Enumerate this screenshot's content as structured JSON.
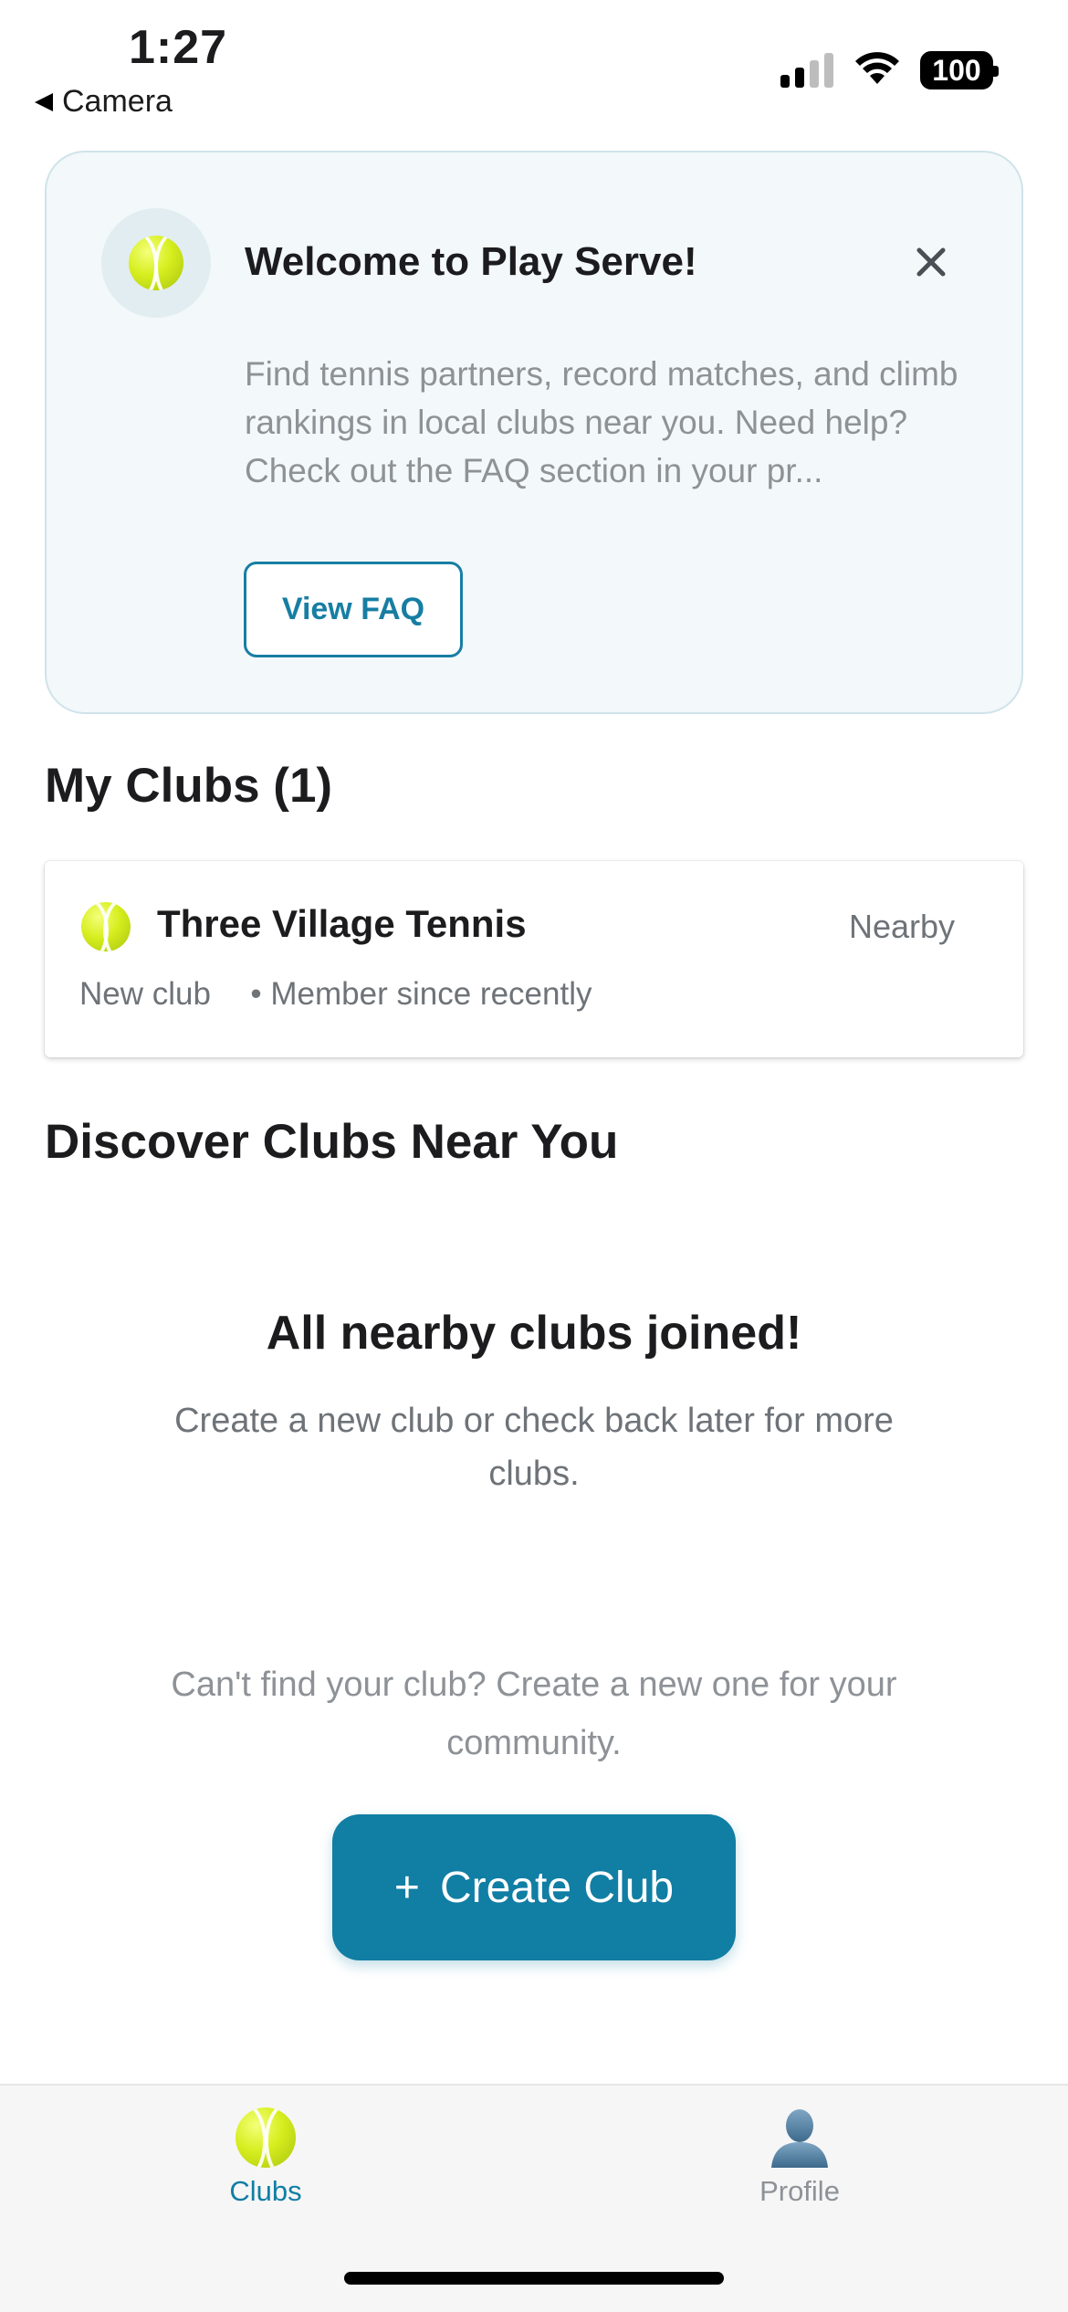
{
  "status_bar": {
    "time": "1:27",
    "back_label": "Camera",
    "battery": "100"
  },
  "welcome": {
    "title": "Welcome to Play Serve!",
    "text": "Find tennis partners, record matches, and climb rankings in local clubs near you. Need help? Check out the FAQ section in your pr...",
    "faq_button": "View FAQ"
  },
  "my_clubs": {
    "heading": "My Clubs (1)",
    "clubs": [
      {
        "name": "Three Village Tennis",
        "distance": "Nearby",
        "status": "New club",
        "member": "• Member since recently"
      }
    ]
  },
  "discover": {
    "heading": "Discover Clubs Near You",
    "empty_title": "All nearby clubs joined!",
    "empty_text": "Create a new club or check back later for more clubs.",
    "cta_text": "Can't find your club? Create a new one for your community.",
    "create_button": "Create Club",
    "create_icon": "+"
  },
  "tabbar": {
    "tabs": [
      {
        "label": "Clubs",
        "icon": "tennis-ball-icon",
        "active": true
      },
      {
        "label": "Profile",
        "icon": "person-icon",
        "active": false
      }
    ]
  },
  "colors": {
    "accent": "#117ea4",
    "card_bg": "#f3f8fa",
    "muted_text": "#8e9297"
  }
}
